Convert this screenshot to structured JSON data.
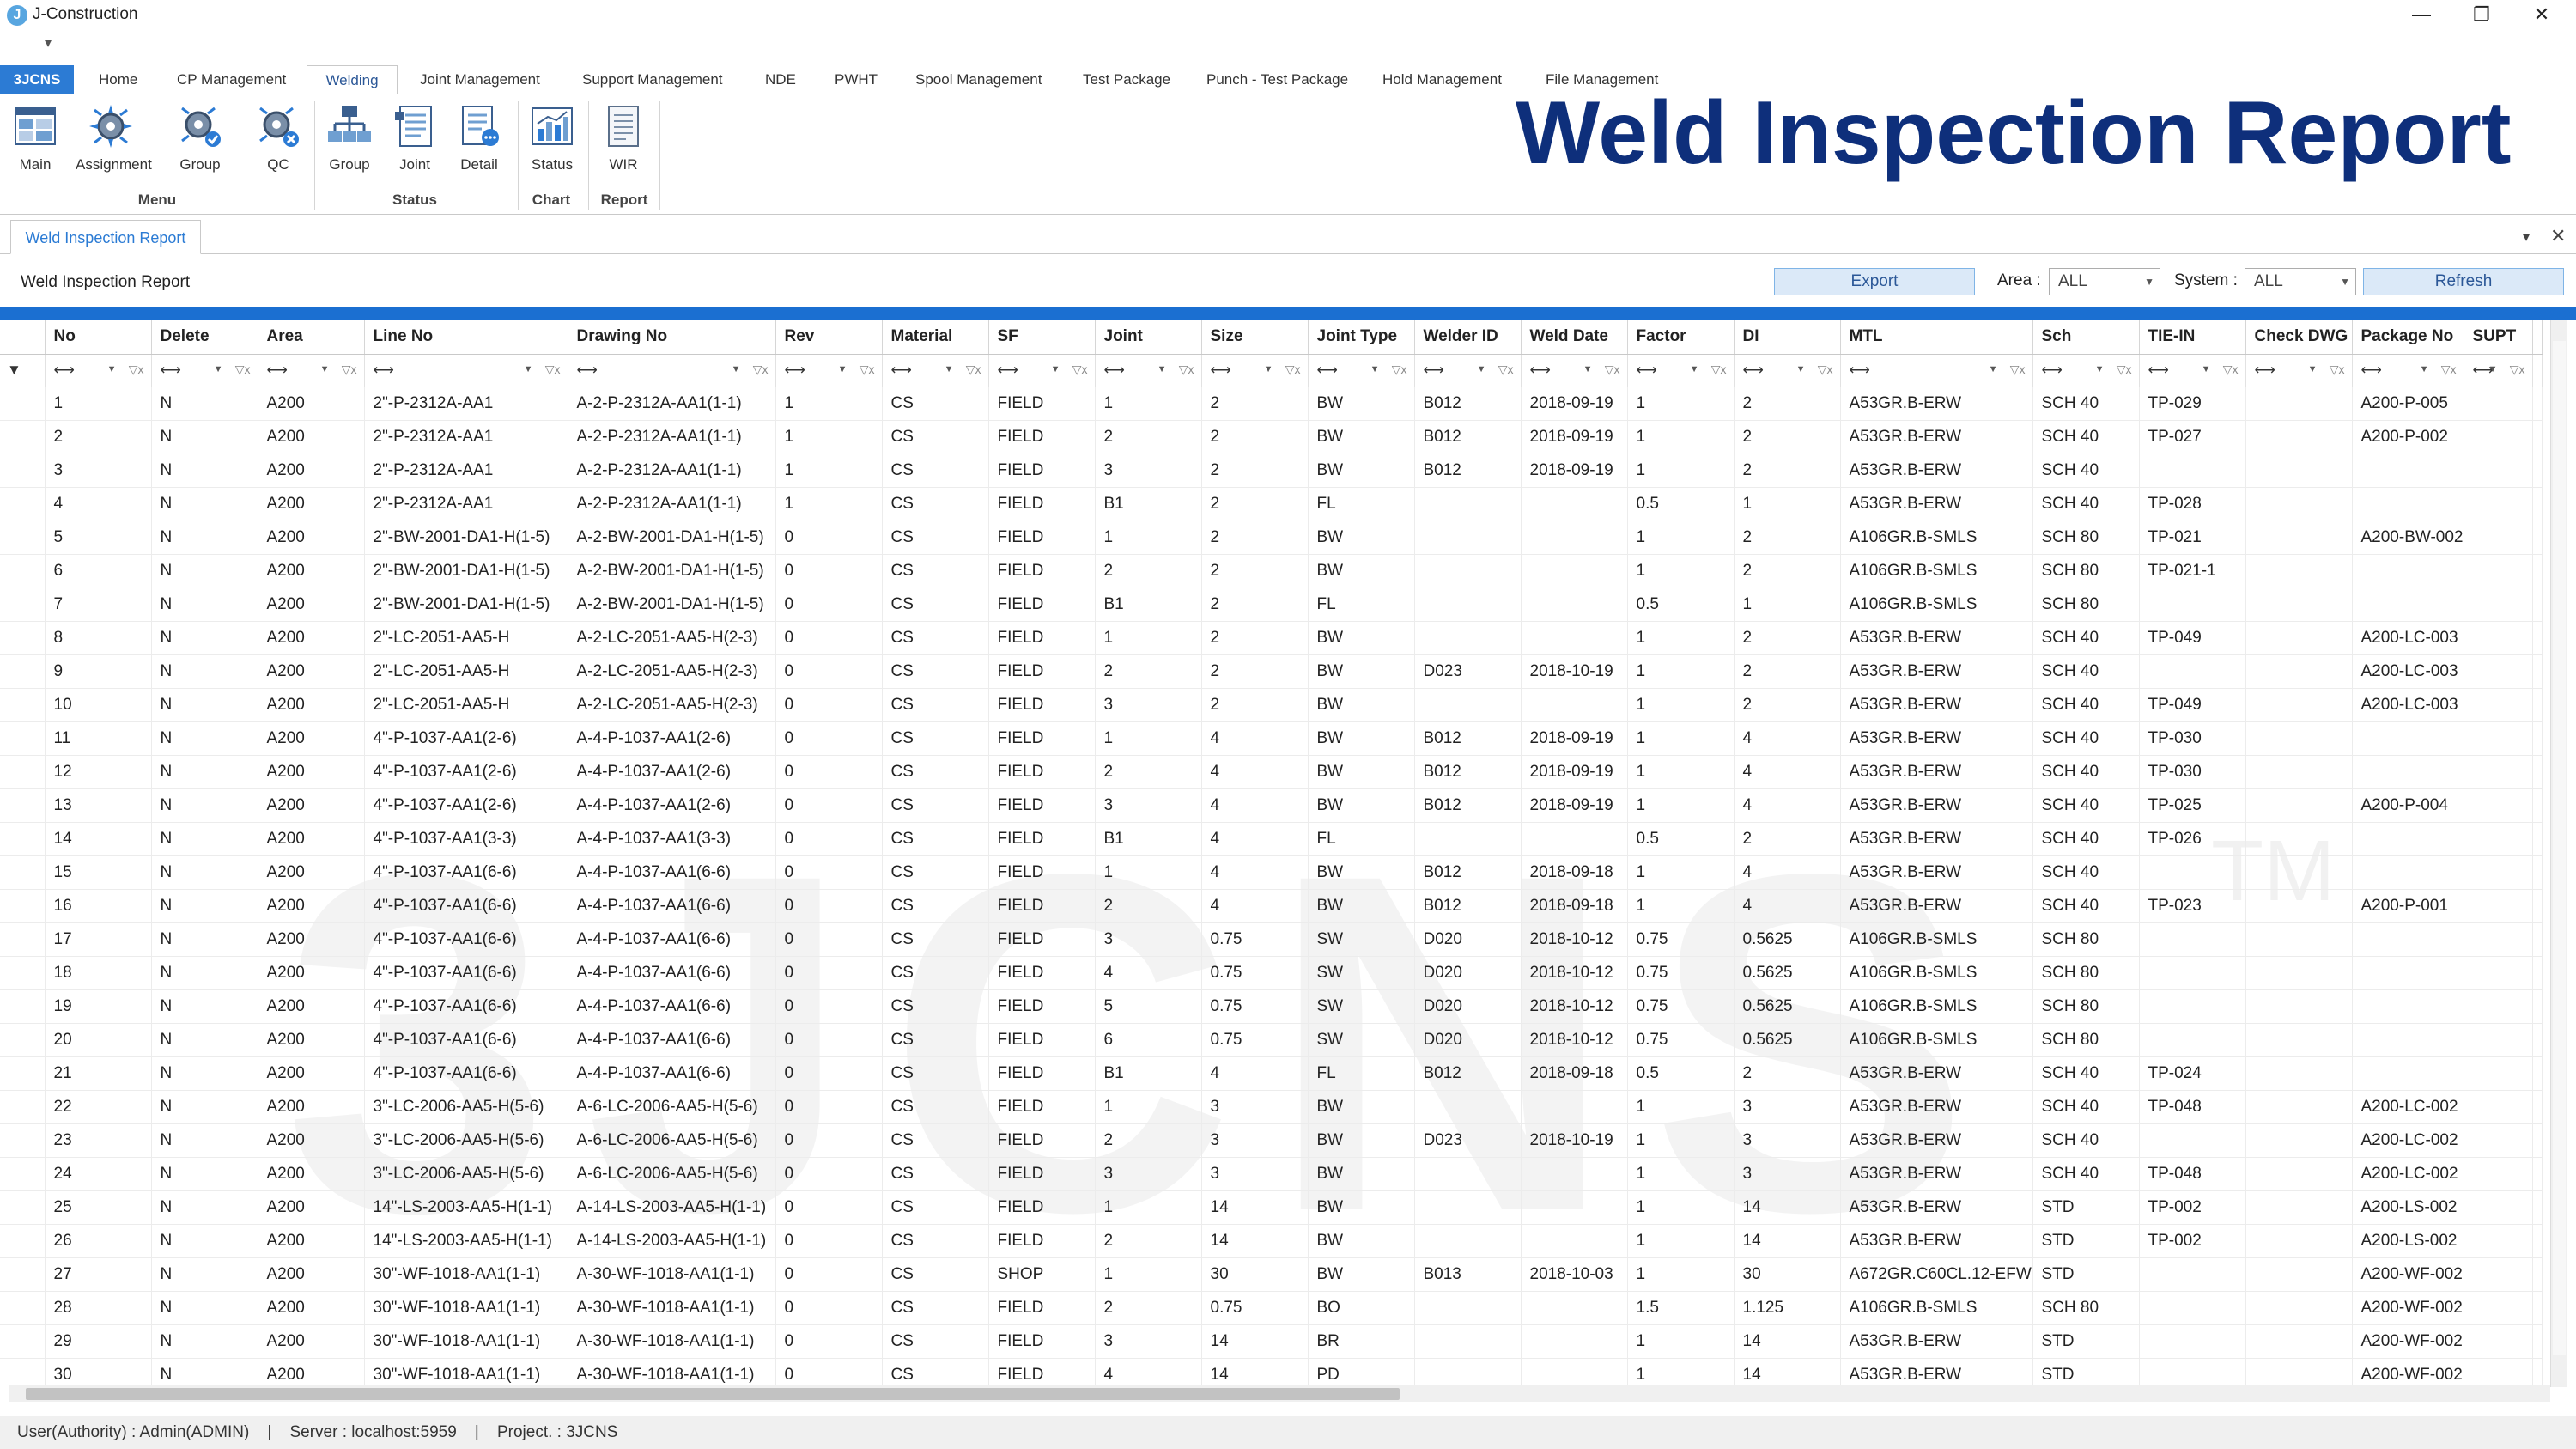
{
  "app": {
    "title": "J-Construction",
    "icon_letter": "J"
  },
  "window": {
    "minimize": "—",
    "restore": "❐",
    "close": "✕"
  },
  "qat": "▾",
  "tabs": [
    "3JCNS",
    "Home",
    "CP Management",
    "Welding",
    "Joint Management",
    "Support Management",
    "NDE",
    "PWHT",
    "Spool Management",
    "Test Package",
    "Punch - Test Package",
    "Hold Management",
    "File Management"
  ],
  "active_tab": "Welding",
  "ribbon": {
    "buttons": [
      {
        "label": "Main",
        "icon": "main-grid-icon"
      },
      {
        "label": "Assignment",
        "icon": "gear-spark-icon"
      },
      {
        "label": "Group",
        "icon": "gear-group-icon"
      },
      {
        "label": "QC",
        "icon": "gear-qc-icon"
      },
      {
        "label": "Group",
        "icon": "hierarchy-icon"
      },
      {
        "label": "Joint",
        "icon": "joint-list-icon"
      },
      {
        "label": "Detail",
        "icon": "detail-list-icon"
      },
      {
        "label": "Status",
        "icon": "bar-chart-icon"
      },
      {
        "label": "WIR",
        "icon": "report-doc-icon"
      }
    ],
    "groups": {
      "menu": "Menu",
      "status": "Status",
      "chart": "Chart",
      "report": "Report"
    }
  },
  "page_title": "Weld Inspection Report",
  "doc_tab": "Weld Inspection Report",
  "toolbar": {
    "title": "Weld Inspection Report",
    "export": "Export",
    "area_label": "Area :",
    "area_value": "ALL",
    "system_label": "System :",
    "system_value": "ALL",
    "refresh": "Refresh"
  },
  "watermark": "3JCNS",
  "watermark_tm": "TM",
  "columns": [
    "No",
    "Delete",
    "Area",
    "Line No",
    "Drawing No",
    "Rev",
    "Material",
    "SF",
    "Joint",
    "Size",
    "Joint Type",
    "Welder ID",
    "Weld Date",
    "Factor",
    "DI",
    "MTL",
    "Sch",
    "TIE-IN",
    "Check DWG",
    "Package No",
    "SUPT"
  ],
  "rows": [
    [
      "1",
      "N",
      "A200",
      "2\"-P-2312A-AA1",
      "A-2-P-2312A-AA1(1-1)",
      "1",
      "CS",
      "FIELD",
      "1",
      "2",
      "BW",
      "B012",
      "2018-09-19",
      "1",
      "2",
      "A53GR.B-ERW",
      "SCH 40",
      "TP-029",
      "",
      "A200-P-005",
      ""
    ],
    [
      "2",
      "N",
      "A200",
      "2\"-P-2312A-AA1",
      "A-2-P-2312A-AA1(1-1)",
      "1",
      "CS",
      "FIELD",
      "2",
      "2",
      "BW",
      "B012",
      "2018-09-19",
      "1",
      "2",
      "A53GR.B-ERW",
      "SCH 40",
      "TP-027",
      "",
      "A200-P-002",
      ""
    ],
    [
      "3",
      "N",
      "A200",
      "2\"-P-2312A-AA1",
      "A-2-P-2312A-AA1(1-1)",
      "1",
      "CS",
      "FIELD",
      "3",
      "2",
      "BW",
      "B012",
      "2018-09-19",
      "1",
      "2",
      "A53GR.B-ERW",
      "SCH 40",
      "",
      "",
      "",
      ""
    ],
    [
      "4",
      "N",
      "A200",
      "2\"-P-2312A-AA1",
      "A-2-P-2312A-AA1(1-1)",
      "1",
      "CS",
      "FIELD",
      "B1",
      "2",
      "FL",
      "",
      "",
      "0.5",
      "1",
      "A53GR.B-ERW",
      "SCH 40",
      "TP-028",
      "",
      "",
      ""
    ],
    [
      "5",
      "N",
      "A200",
      "2\"-BW-2001-DA1-H(1-5)",
      "A-2-BW-2001-DA1-H(1-5)",
      "0",
      "CS",
      "FIELD",
      "1",
      "2",
      "BW",
      "",
      "",
      "1",
      "2",
      "A106GR.B-SMLS",
      "SCH 80",
      "TP-021",
      "",
      "A200-BW-002",
      ""
    ],
    [
      "6",
      "N",
      "A200",
      "2\"-BW-2001-DA1-H(1-5)",
      "A-2-BW-2001-DA1-H(1-5)",
      "0",
      "CS",
      "FIELD",
      "2",
      "2",
      "BW",
      "",
      "",
      "1",
      "2",
      "A106GR.B-SMLS",
      "SCH 80",
      "TP-021-1",
      "",
      "",
      ""
    ],
    [
      "7",
      "N",
      "A200",
      "2\"-BW-2001-DA1-H(1-5)",
      "A-2-BW-2001-DA1-H(1-5)",
      "0",
      "CS",
      "FIELD",
      "B1",
      "2",
      "FL",
      "",
      "",
      "0.5",
      "1",
      "A106GR.B-SMLS",
      "SCH 80",
      "",
      "",
      "",
      ""
    ],
    [
      "8",
      "N",
      "A200",
      "2\"-LC-2051-AA5-H",
      "A-2-LC-2051-AA5-H(2-3)",
      "0",
      "CS",
      "FIELD",
      "1",
      "2",
      "BW",
      "",
      "",
      "1",
      "2",
      "A53GR.B-ERW",
      "SCH 40",
      "TP-049",
      "",
      "A200-LC-003",
      ""
    ],
    [
      "9",
      "N",
      "A200",
      "2\"-LC-2051-AA5-H",
      "A-2-LC-2051-AA5-H(2-3)",
      "0",
      "CS",
      "FIELD",
      "2",
      "2",
      "BW",
      "D023",
      "2018-10-19",
      "1",
      "2",
      "A53GR.B-ERW",
      "SCH 40",
      "",
      "",
      "A200-LC-003",
      ""
    ],
    [
      "10",
      "N",
      "A200",
      "2\"-LC-2051-AA5-H",
      "A-2-LC-2051-AA5-H(2-3)",
      "0",
      "CS",
      "FIELD",
      "3",
      "2",
      "BW",
      "",
      "",
      "1",
      "2",
      "A53GR.B-ERW",
      "SCH 40",
      "TP-049",
      "",
      "A200-LC-003",
      ""
    ],
    [
      "11",
      "N",
      "A200",
      "4\"-P-1037-AA1(2-6)",
      "A-4-P-1037-AA1(2-6)",
      "0",
      "CS",
      "FIELD",
      "1",
      "4",
      "BW",
      "B012",
      "2018-09-19",
      "1",
      "4",
      "A53GR.B-ERW",
      "SCH 40",
      "TP-030",
      "",
      "",
      ""
    ],
    [
      "12",
      "N",
      "A200",
      "4\"-P-1037-AA1(2-6)",
      "A-4-P-1037-AA1(2-6)",
      "0",
      "CS",
      "FIELD",
      "2",
      "4",
      "BW",
      "B012",
      "2018-09-19",
      "1",
      "4",
      "A53GR.B-ERW",
      "SCH 40",
      "TP-030",
      "",
      "",
      ""
    ],
    [
      "13",
      "N",
      "A200",
      "4\"-P-1037-AA1(2-6)",
      "A-4-P-1037-AA1(2-6)",
      "0",
      "CS",
      "FIELD",
      "3",
      "4",
      "BW",
      "B012",
      "2018-09-19",
      "1",
      "4",
      "A53GR.B-ERW",
      "SCH 40",
      "TP-025",
      "",
      "A200-P-004",
      ""
    ],
    [
      "14",
      "N",
      "A200",
      "4\"-P-1037-AA1(3-3)",
      "A-4-P-1037-AA1(3-3)",
      "0",
      "CS",
      "FIELD",
      "B1",
      "4",
      "FL",
      "",
      "",
      "0.5",
      "2",
      "A53GR.B-ERW",
      "SCH 40",
      "TP-026",
      "",
      "",
      ""
    ],
    [
      "15",
      "N",
      "A200",
      "4\"-P-1037-AA1(6-6)",
      "A-4-P-1037-AA1(6-6)",
      "0",
      "CS",
      "FIELD",
      "1",
      "4",
      "BW",
      "B012",
      "2018-09-18",
      "1",
      "4",
      "A53GR.B-ERW",
      "SCH 40",
      "",
      "",
      "",
      ""
    ],
    [
      "16",
      "N",
      "A200",
      "4\"-P-1037-AA1(6-6)",
      "A-4-P-1037-AA1(6-6)",
      "0",
      "CS",
      "FIELD",
      "2",
      "4",
      "BW",
      "B012",
      "2018-09-18",
      "1",
      "4",
      "A53GR.B-ERW",
      "SCH 40",
      "TP-023",
      "",
      "A200-P-001",
      ""
    ],
    [
      "17",
      "N",
      "A200",
      "4\"-P-1037-AA1(6-6)",
      "A-4-P-1037-AA1(6-6)",
      "0",
      "CS",
      "FIELD",
      "3",
      "0.75",
      "SW",
      "D020",
      "2018-10-12",
      "0.75",
      "0.5625",
      "A106GR.B-SMLS",
      "SCH 80",
      "",
      "",
      "",
      ""
    ],
    [
      "18",
      "N",
      "A200",
      "4\"-P-1037-AA1(6-6)",
      "A-4-P-1037-AA1(6-6)",
      "0",
      "CS",
      "FIELD",
      "4",
      "0.75",
      "SW",
      "D020",
      "2018-10-12",
      "0.75",
      "0.5625",
      "A106GR.B-SMLS",
      "SCH 80",
      "",
      "",
      "",
      ""
    ],
    [
      "19",
      "N",
      "A200",
      "4\"-P-1037-AA1(6-6)",
      "A-4-P-1037-AA1(6-6)",
      "0",
      "CS",
      "FIELD",
      "5",
      "0.75",
      "SW",
      "D020",
      "2018-10-12",
      "0.75",
      "0.5625",
      "A106GR.B-SMLS",
      "SCH 80",
      "",
      "",
      "",
      ""
    ],
    [
      "20",
      "N",
      "A200",
      "4\"-P-1037-AA1(6-6)",
      "A-4-P-1037-AA1(6-6)",
      "0",
      "CS",
      "FIELD",
      "6",
      "0.75",
      "SW",
      "D020",
      "2018-10-12",
      "0.75",
      "0.5625",
      "A106GR.B-SMLS",
      "SCH 80",
      "",
      "",
      "",
      ""
    ],
    [
      "21",
      "N",
      "A200",
      "4\"-P-1037-AA1(6-6)",
      "A-4-P-1037-AA1(6-6)",
      "0",
      "CS",
      "FIELD",
      "B1",
      "4",
      "FL",
      "B012",
      "2018-09-18",
      "0.5",
      "2",
      "A53GR.B-ERW",
      "SCH 40",
      "TP-024",
      "",
      "",
      ""
    ],
    [
      "22",
      "N",
      "A200",
      "3\"-LC-2006-AA5-H(5-6)",
      "A-6-LC-2006-AA5-H(5-6)",
      "0",
      "CS",
      "FIELD",
      "1",
      "3",
      "BW",
      "",
      "",
      "1",
      "3",
      "A53GR.B-ERW",
      "SCH 40",
      "TP-048",
      "",
      "A200-LC-002",
      ""
    ],
    [
      "23",
      "N",
      "A200",
      "3\"-LC-2006-AA5-H(5-6)",
      "A-6-LC-2006-AA5-H(5-6)",
      "0",
      "CS",
      "FIELD",
      "2",
      "3",
      "BW",
      "D023",
      "2018-10-19",
      "1",
      "3",
      "A53GR.B-ERW",
      "SCH 40",
      "",
      "",
      "A200-LC-002",
      ""
    ],
    [
      "24",
      "N",
      "A200",
      "3\"-LC-2006-AA5-H(5-6)",
      "A-6-LC-2006-AA5-H(5-6)",
      "0",
      "CS",
      "FIELD",
      "3",
      "3",
      "BW",
      "",
      "",
      "1",
      "3",
      "A53GR.B-ERW",
      "SCH 40",
      "TP-048",
      "",
      "A200-LC-002",
      ""
    ],
    [
      "25",
      "N",
      "A200",
      "14\"-LS-2003-AA5-H(1-1)",
      "A-14-LS-2003-AA5-H(1-1)",
      "0",
      "CS",
      "FIELD",
      "1",
      "14",
      "BW",
      "",
      "",
      "1",
      "14",
      "A53GR.B-ERW",
      "STD",
      "TP-002",
      "",
      "A200-LS-002",
      ""
    ],
    [
      "26",
      "N",
      "A200",
      "14\"-LS-2003-AA5-H(1-1)",
      "A-14-LS-2003-AA5-H(1-1)",
      "0",
      "CS",
      "FIELD",
      "2",
      "14",
      "BW",
      "",
      "",
      "1",
      "14",
      "A53GR.B-ERW",
      "STD",
      "TP-002",
      "",
      "A200-LS-002",
      ""
    ],
    [
      "27",
      "N",
      "A200",
      "30\"-WF-1018-AA1(1-1)",
      "A-30-WF-1018-AA1(1-1)",
      "0",
      "CS",
      "SHOP",
      "1",
      "30",
      "BW",
      "B013",
      "2018-10-03",
      "1",
      "30",
      "A672GR.C60CL.12-EFW",
      "STD",
      "",
      "",
      "A200-WF-002",
      ""
    ],
    [
      "28",
      "N",
      "A200",
      "30\"-WF-1018-AA1(1-1)",
      "A-30-WF-1018-AA1(1-1)",
      "0",
      "CS",
      "FIELD",
      "2",
      "0.75",
      "BO",
      "",
      "",
      "1.5",
      "1.125",
      "A106GR.B-SMLS",
      "SCH 80",
      "",
      "",
      "A200-WF-002",
      ""
    ],
    [
      "29",
      "N",
      "A200",
      "30\"-WF-1018-AA1(1-1)",
      "A-30-WF-1018-AA1(1-1)",
      "0",
      "CS",
      "FIELD",
      "3",
      "14",
      "BR",
      "",
      "",
      "1",
      "14",
      "A53GR.B-ERW",
      "STD",
      "",
      "",
      "A200-WF-002",
      ""
    ],
    [
      "30",
      "N",
      "A200",
      "30\"-WF-1018-AA1(1-1)",
      "A-30-WF-1018-AA1(1-1)",
      "0",
      "CS",
      "FIELD",
      "4",
      "14",
      "PD",
      "",
      "",
      "1",
      "14",
      "A53GR.B-ERW",
      "STD",
      "",
      "",
      "A200-WF-002",
      ""
    ]
  ],
  "status": {
    "user": "User(Authority) : Admin(ADMIN)",
    "server": "Server : localhost:5959",
    "project": "Project. : 3JCNS"
  },
  "colors": {
    "accent": "#1b6fd1",
    "title": "#0e2f7b",
    "file_tab": "#2c7bd4"
  }
}
